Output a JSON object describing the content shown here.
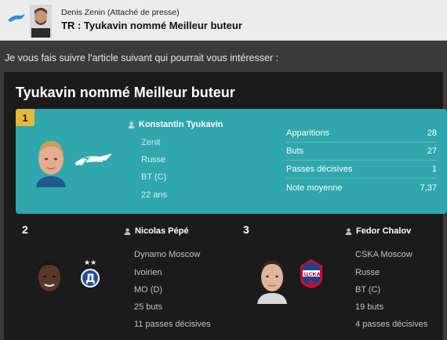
{
  "header": {
    "sender_name": "Denis Zenin",
    "sender_role": "(Attaché de presse)",
    "subject": "TR : Tyukavin nommé Meilleur buteur"
  },
  "intro_text": "Je vous fais suivre l'article suivant qui pourrait vous intéresser :",
  "article": {
    "title": "Tyukavin nommé Meilleur buteur",
    "first": {
      "rank": "1",
      "name": "Konstantin Tyukavin",
      "club": "Zenit",
      "nationality": "Russe",
      "position": "BT (C)",
      "age": "22 ans",
      "stats": [
        {
          "label": "Apparitions",
          "value": "28"
        },
        {
          "label": "Buts",
          "value": "27"
        },
        {
          "label": "Passes décisives",
          "value": "1"
        },
        {
          "label": "Note moyenne",
          "value": "7,37"
        }
      ]
    },
    "second": {
      "rank": "2",
      "name": "Nicolas Pépé",
      "club": "Dynamo Moscow",
      "nationality": "Ivoirien",
      "position": "MO (D)",
      "goals": "25 buts",
      "assists": "11 passes décisives"
    },
    "third": {
      "rank": "3",
      "name": "Fedor Chalov",
      "club": "CSKA Moscow",
      "nationality": "Russe",
      "position": "BT (C)",
      "goals": "19 buts",
      "assists": "4 passes décisives"
    }
  },
  "colors": {
    "highlight": "#2fa7ad",
    "rank_gold": "#e2b93b",
    "background": "#3a3a3a",
    "card": "#1b1b1b"
  },
  "icons": [
    "zenit-badge",
    "person-icon",
    "dynamo-badge",
    "cska-badge"
  ]
}
